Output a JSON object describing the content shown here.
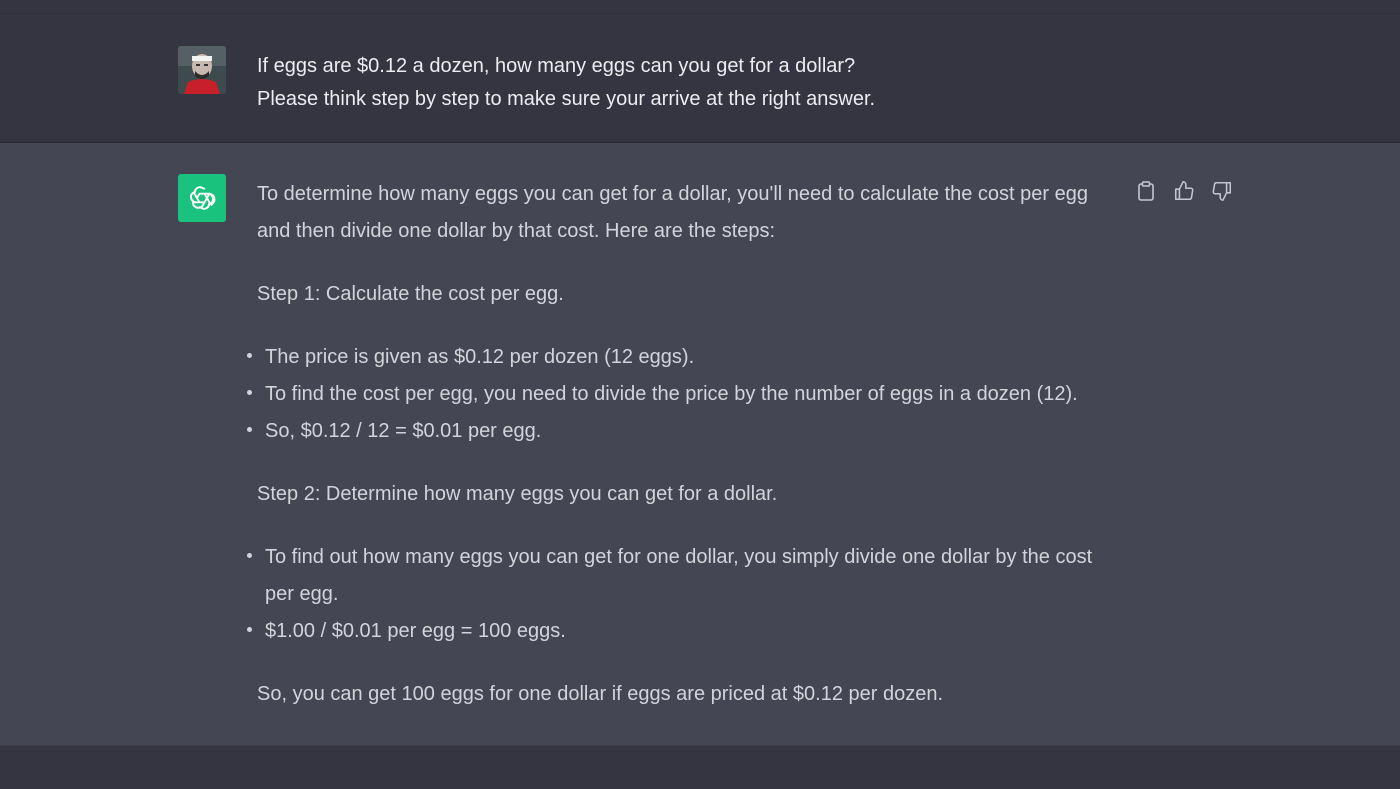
{
  "user_message": {
    "line1": "If eggs are $0.12 a dozen, how many eggs can you get for a dollar?",
    "line2": "Please  think step by step to make sure your arrive at the right answer."
  },
  "assistant_message": {
    "intro": "To determine how many eggs you can get for a dollar, you'll need to calculate the cost per egg and then divide one dollar by that cost. Here are the steps:",
    "step1_title": "Step 1: Calculate the cost per egg.",
    "step1_bullets": [
      "The price is given as $0.12 per dozen (12 eggs).",
      "To find the cost per egg, you need to divide the price by the number of eggs in a dozen (12).",
      "So, $0.12 / 12 = $0.01 per egg."
    ],
    "step2_title": "Step 2: Determine how many eggs you can get for a dollar.",
    "step2_bullets": [
      "To find out how many eggs you can get for one dollar, you simply divide one dollar by the cost per egg.",
      "$1.00 / $0.01 per egg = 100 eggs."
    ],
    "conclusion": "So, you can get 100 eggs for one dollar if eggs are priced at $0.12 per dozen."
  },
  "actions": {
    "copy_icon": "clipboard-icon",
    "like_icon": "thumbs-up-icon",
    "dislike_icon": "thumbs-down-icon"
  },
  "colors": {
    "background": "#343541",
    "assistant_background": "#444654",
    "bot_avatar": "#19c37d",
    "text": "#d1d5db"
  }
}
